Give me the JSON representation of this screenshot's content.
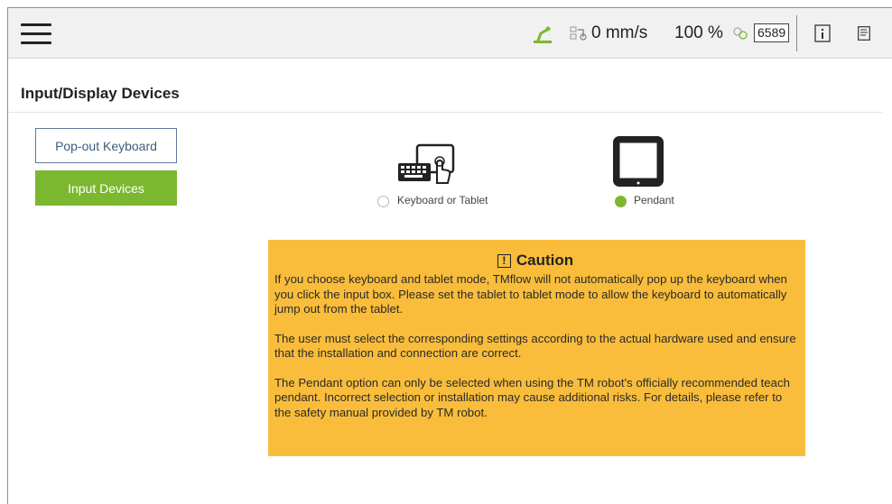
{
  "topbar": {
    "speed": "0 mm/s",
    "percent": "100 %",
    "count": "6589",
    "icons": [
      "hamburger-menu-icon",
      "robot-arm-icon",
      "speed-icon",
      "link-icon",
      "info-icon",
      "document-icon"
    ]
  },
  "page": {
    "title": "Input/Display Devices"
  },
  "sidebar": {
    "popout_label": "Pop-out Keyboard",
    "input_devices_label": "Input Devices"
  },
  "devices": {
    "keyboard_label": "Keyboard or Tablet",
    "pendant_label": "Pendant",
    "selected": "Pendant"
  },
  "caution": {
    "title": "Caution",
    "paragraphs": [
      "If you choose keyboard and tablet mode, TMflow will not automatically pop up the keyboard when you click the input box. Please set the tablet to tablet mode to allow the keyboard to automatically jump out from the tablet.",
      "The user must select the corresponding settings according to the actual hardware used and ensure that the installation and connection are correct.",
      "The Pendant option can only be selected when using the TM robot's officially recommended teach pendant. Incorrect selection or installation may cause additional risks. For details, please refer to the safety manual provided by TM robot."
    ]
  },
  "colors": {
    "accent_green": "#7bb82f",
    "caution_bg": "#f9bd3b",
    "popout_border": "#5d7b99"
  }
}
